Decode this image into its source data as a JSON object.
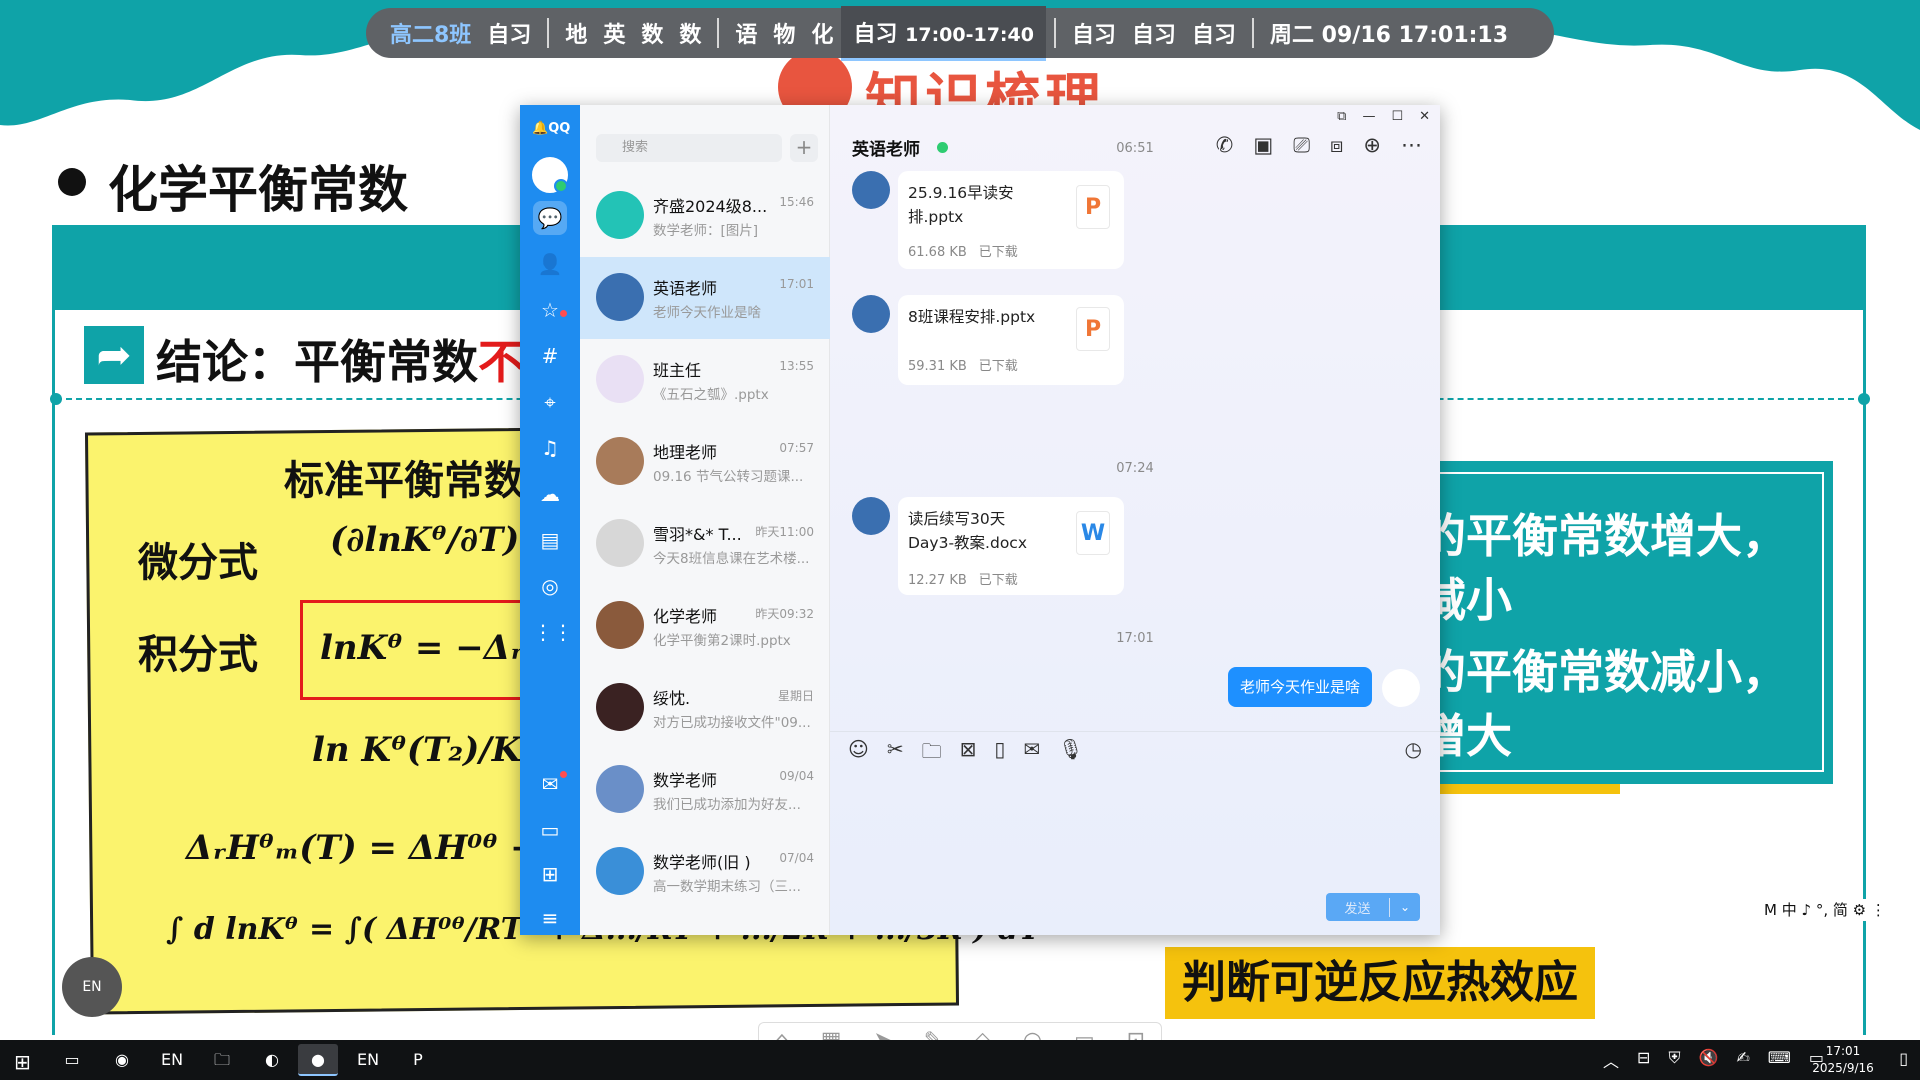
{
  "schedule": {
    "class_name": "高二8班",
    "items_before": [
      "自习"
    ],
    "subjects_a": [
      "地",
      "英",
      "数",
      "数"
    ],
    "subjects_b": [
      "语",
      "物",
      "化"
    ],
    "current": {
      "label": "自习",
      "time": "17:00-17:40"
    },
    "items_after": [
      "自习",
      "自习",
      "自习"
    ],
    "date_time": "周二 09/16  17:01:13"
  },
  "slide": {
    "logo_text": "知识梳理",
    "title": "化学平衡常数",
    "conclusion_prefix": "结论：平衡常数",
    "conclusion_red": "不变",
    "card_title": "标准平衡常数",
    "diff_label": "微分式",
    "int_label": "积分式",
    "eq1": "(∂lnKᶿ/∂T)ₚ = ...",
    "eq2": "lnKᶿ = −ΔᵣH/RT",
    "eq3": "ln Kᶿ(T₂)/Kᶿ(T₁) = ΔᵣH...",
    "eq4": "ΔᵣHᶿₘ(T) = ΔH⁰ᶿ +(Δ...",
    "eq5": "∫ d lnKᶿ = ∫( ΔH⁰ᶿ/RT² + Δ.../RT + .../2R + .../3R ) dT",
    "right_line1": "的平衡常数增大，",
    "right_line2": "减小",
    "right_line3": "的平衡常数减小，",
    "right_line4": "增大",
    "bottom_label": "判断可逆反应热效应",
    "ime_text": "M 中 ♪ °, 简 ⚙ ⋮",
    "en_badge": "EN"
  },
  "qq": {
    "app_label": "QQ",
    "search_placeholder": "搜索",
    "chats": [
      {
        "name": "齐盛2024级8...",
        "time": "15:46",
        "preview": "数学老师：[图片]",
        "avatar_color": "#23c3b6",
        "selected": false
      },
      {
        "name": "英语老师",
        "time": "17:01",
        "preview": "老师今天作业是啥",
        "avatar_color": "#3a6fb0",
        "selected": true
      },
      {
        "name": "班主任",
        "time": "13:55",
        "preview": "《五石之瓠》.pptx",
        "avatar_color": "#e9e0f4",
        "selected": false
      },
      {
        "name": "地理老师",
        "time": "07:57",
        "preview": "09.16 节气公转习题课...",
        "avatar_color": "#a87b5a",
        "selected": false
      },
      {
        "name": "雪羽*&* T...",
        "time": "昨天11:00",
        "preview": "今天8班信息课在艺术楼...",
        "avatar_color": "#d7d7d7",
        "selected": false
      },
      {
        "name": "化学老师",
        "time": "昨天09:32",
        "preview": "化学平衡第2课时.pptx",
        "avatar_color": "#8a5a3c",
        "selected": false
      },
      {
        "name": "绥忱.",
        "time": "星期日",
        "preview": "对方已成功接收文件\"09...",
        "avatar_color": "#3a2222",
        "selected": false
      },
      {
        "name": "数学老师",
        "time": "09/04",
        "preview": "我们已成功添加为好友...",
        "avatar_color": "#6a8fc8",
        "selected": false
      },
      {
        "name": "数学老师(旧 )",
        "time": "07/04",
        "preview": "高一数学期末练习（三...",
        "avatar_color": "#3a8fd8",
        "selected": false
      }
    ],
    "current_chat": {
      "title": "英语老师",
      "timestamps": [
        "06:51",
        "07:24",
        "17:01"
      ],
      "files": [
        {
          "name": "25.9.16早读安排.pptx",
          "size": "61.68 KB",
          "status": "已下载",
          "type": "P"
        },
        {
          "name": "8班课程安排.pptx",
          "size": "59.31 KB",
          "status": "已下载",
          "type": "P"
        },
        {
          "name": "读后续写30天Day3-教案.docx",
          "size": "12.27 KB",
          "status": "已下载",
          "type": "W"
        }
      ],
      "my_message": "老师今天作业是啥",
      "send_label": "发送"
    }
  },
  "taskbar": {
    "clock_time": "17:01",
    "clock_date": "2025/9/16"
  }
}
